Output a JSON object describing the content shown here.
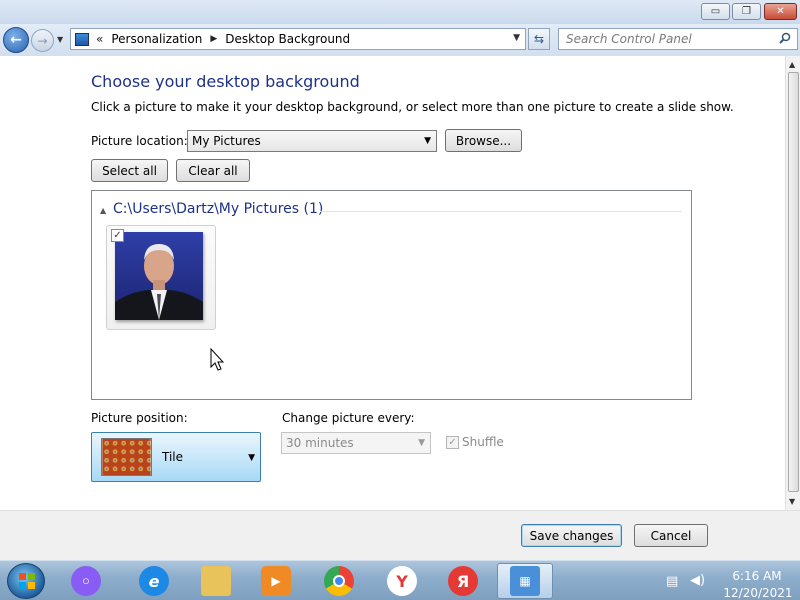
{
  "window": {
    "controls": {
      "minimize": "▭",
      "maximize": "❐",
      "close": "✕"
    }
  },
  "navigation": {
    "breadcrumb": [
      "Personalization",
      "Desktop Background"
    ],
    "overflow": "«",
    "search_placeholder": "Search Control Panel"
  },
  "main": {
    "title": "Choose your desktop background",
    "description": "Click a picture to make it your desktop background, or select more than one picture to create a slide show.",
    "picture_location_label": "Picture location:",
    "picture_location_value": "My Pictures",
    "browse_label": "Browse...",
    "select_all_label": "Select all",
    "clear_all_label": "Clear all",
    "gallery": {
      "group_title": "C:\\Users\\Dartz\\My Pictures (1)",
      "items": [
        {
          "checked": true,
          "icon": "portrait-photo-thumbnail"
        }
      ]
    },
    "picture_position_label": "Picture position:",
    "picture_position_value": "Tile",
    "change_picture_label": "Change picture every:",
    "change_picture_value": "30 minutes",
    "shuffle_label": "Shuffle",
    "shuffle_checked": true
  },
  "footer": {
    "save_label": "Save changes",
    "cancel_label": "Cancel"
  },
  "taskbar": {
    "apps": [
      {
        "name": "alice-assistant",
        "color": "#8a5cf6"
      },
      {
        "name": "internet-explorer",
        "color": "#1e88e5"
      },
      {
        "name": "file-explorer",
        "color": "#e8c25a"
      },
      {
        "name": "media-player",
        "color": "#f08a24"
      },
      {
        "name": "chrome",
        "color": "#34a853"
      },
      {
        "name": "yandex-browser",
        "color": "#e53935"
      },
      {
        "name": "yandex",
        "color": "#e53935"
      },
      {
        "name": "control-panel",
        "color": "#4a90d9"
      }
    ],
    "clock_time": "6:16 AM",
    "clock_date": "12/20/2021"
  }
}
